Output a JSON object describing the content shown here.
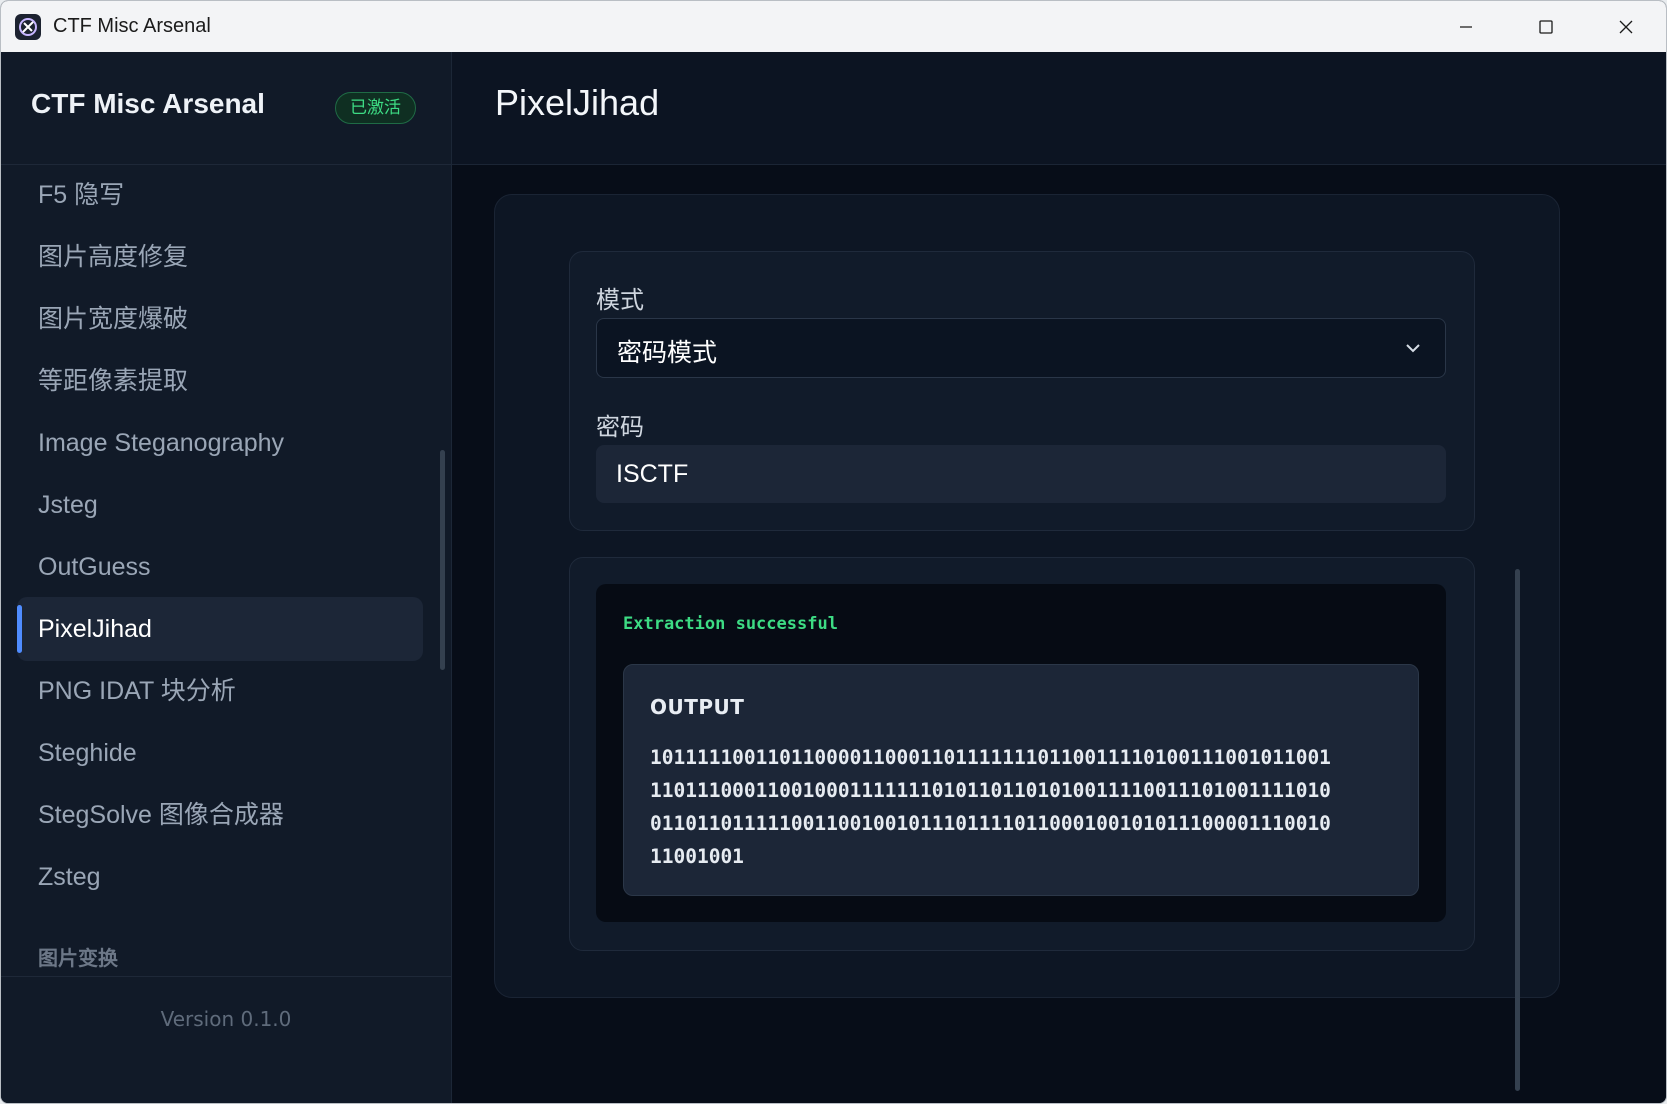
{
  "window": {
    "title": "CTF Misc Arsenal",
    "controls": [
      "minimize-icon",
      "maximize-icon",
      "close-icon"
    ]
  },
  "sidebar": {
    "brand": "CTF Misc Arsenal",
    "badge": "已激活",
    "items": [
      {
        "label": "F5 隐写"
      },
      {
        "label": "图片高度修复"
      },
      {
        "label": "图片宽度爆破"
      },
      {
        "label": "等距像素提取"
      },
      {
        "label": "Image Steganography"
      },
      {
        "label": "Jsteg"
      },
      {
        "label": "OutGuess"
      },
      {
        "label": "PixelJihad",
        "active": true
      },
      {
        "label": "PNG IDAT 块分析"
      },
      {
        "label": "Steghide"
      },
      {
        "label": "StegSolve 图像合成器"
      },
      {
        "label": "Zsteg"
      }
    ],
    "section_label": "图片变换",
    "version": "Version 0.1.0"
  },
  "main": {
    "title": "PixelJihad",
    "mode_label": "模式",
    "mode_value": "密码模式",
    "password_label": "密码",
    "password_value": "ISCTF",
    "status": "Extraction successful",
    "output_label": "OUTPUT",
    "output_value": "1011111001101100001100011011111110110011110100111001011001110111000110010001111111010110110101001111001110100111101001101101111100110010010111011110110001001010111000011100101100100 1",
    "output_lines": [
      "1011111001101100001100011011111110110011110100111001011001",
      "1101110001100100011111110101101101010011110011101001111010",
      "0110110111110011001001011101111011000100101011100001110010",
      "11001001"
    ]
  },
  "colors": {
    "accent": "#4f8cff",
    "success": "#3ddc84",
    "sidebar_bg": "#111a28",
    "main_bg": "#070d18"
  }
}
